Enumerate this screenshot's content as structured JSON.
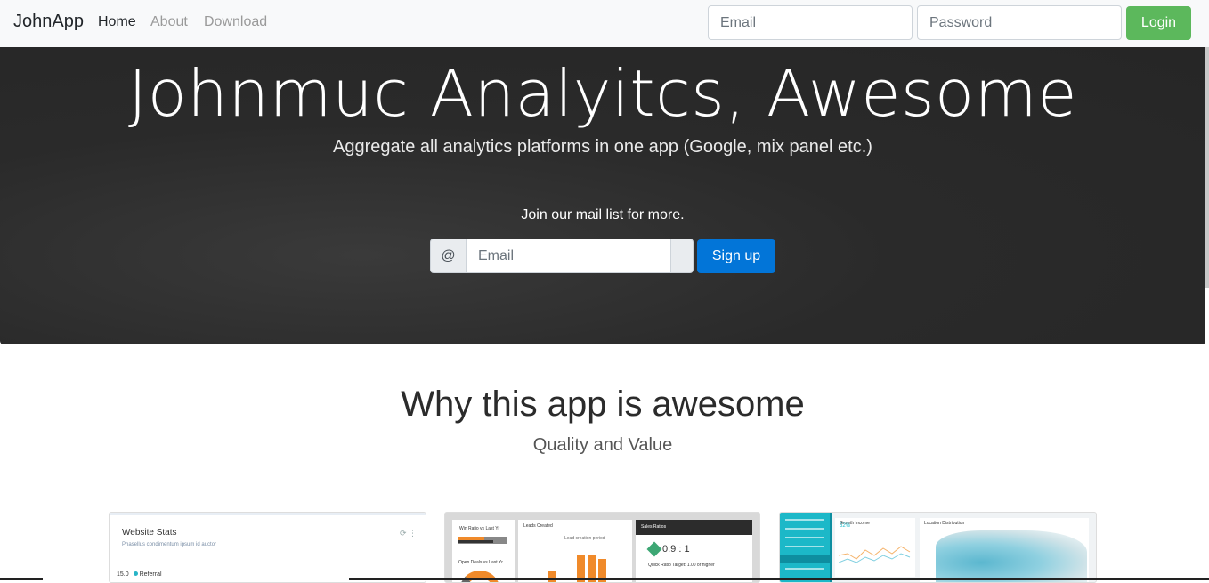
{
  "navbar": {
    "brand": "JohnApp",
    "links": [
      "Home",
      "About",
      "Download"
    ],
    "email_placeholder": "Email",
    "password_placeholder": "Password",
    "login_label": "Login"
  },
  "hero": {
    "title": "Johnmuc Analyitcs, Awesome",
    "subtitle": "Aggregate all analytics platforms in one app (Google, mix panel etc.)",
    "mail_label": "Join our mail list for more.",
    "at_symbol": "@",
    "email_placeholder": "Email",
    "signup_label": "Sign up"
  },
  "features": {
    "title": "Why this app is awesome",
    "subtitle": "Quality and Value"
  },
  "cards": {
    "card1": {
      "title": "Website Stats",
      "subtitle": "Phasellus condimentum ipsum id auctor",
      "legend_value": "15.0",
      "legend_label": "Referral"
    },
    "card2": {
      "win_ratio": "Win Ratio vs Last Yr",
      "open_deals": "Open Deals vs Last Yr",
      "leads_created": "Leads Created",
      "lead_period": "Lead creation period",
      "sales_ratios": "Sales Ratios",
      "ratio_value": "0.9 : 1",
      "quick_ratio": "Quick Ratio Target: 1.00 or higher",
      "bar_levels": [
        0.35,
        0.8,
        0.8,
        0.7
      ]
    },
    "card3": {
      "growth_label": "Growth Income",
      "growth_value": "52%",
      "location_label": "Location Distribution"
    }
  },
  "colors": {
    "login_green": "#5cb85c",
    "signup_blue": "#0275d8",
    "hero_bg": "#2a2a2a",
    "accent_orange": "#f08a2a",
    "accent_teal": "#1cb8c8"
  }
}
